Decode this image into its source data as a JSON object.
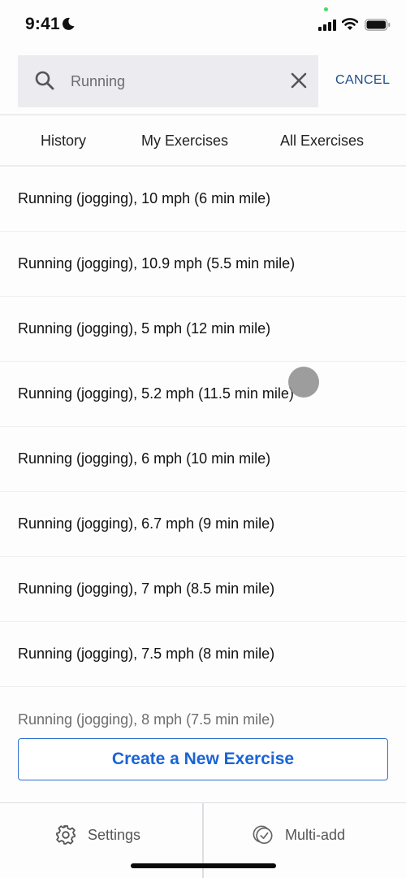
{
  "status_bar": {
    "time": "9:41",
    "icons": [
      "moon-icon",
      "signal-icon",
      "wifi-icon",
      "battery-icon"
    ]
  },
  "search": {
    "value": "Running",
    "placeholder": "Search",
    "cancel_label": "CANCEL"
  },
  "tabs": [
    {
      "label": "History"
    },
    {
      "label": "My Exercises"
    },
    {
      "label": "All Exercises"
    }
  ],
  "results": [
    {
      "label": "Running (jogging), 10 mph (6 min mile)"
    },
    {
      "label": "Running (jogging), 10.9 mph (5.5 min mile)"
    },
    {
      "label": "Running (jogging), 5 mph (12 min mile)"
    },
    {
      "label": "Running (jogging), 5.2 mph (11.5 min mile)"
    },
    {
      "label": "Running (jogging), 6 mph (10 min mile)"
    },
    {
      "label": "Running (jogging), 6.7 mph (9 min mile)"
    },
    {
      "label": "Running (jogging), 7 mph (8.5 min mile)"
    },
    {
      "label": "Running (jogging), 7.5 mph (8 min mile)"
    },
    {
      "label": "Running (jogging), 8 mph (7.5 min mile)"
    }
  ],
  "create_button_label": "Create a New Exercise",
  "bottom_bar": {
    "settings_label": "Settings",
    "multi_add_label": "Multi-add"
  },
  "colors": {
    "accent": "#1a64d4",
    "cancel": "#1e4e8c",
    "search_bg": "#ececf0"
  }
}
